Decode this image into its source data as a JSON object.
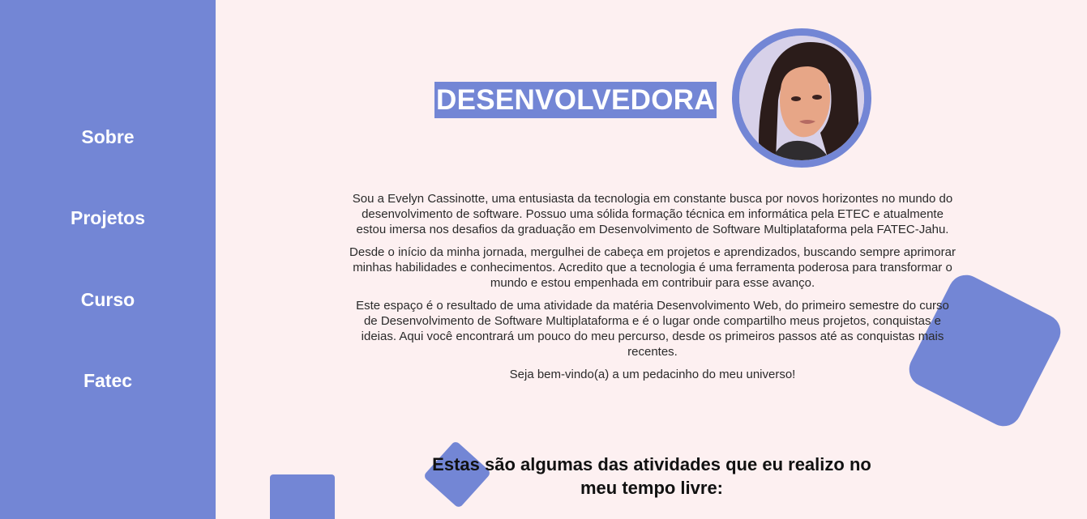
{
  "sidebar": {
    "items": [
      {
        "label": "Sobre"
      },
      {
        "label": "Projetos"
      },
      {
        "label": "Curso"
      },
      {
        "label": "Fatec"
      }
    ]
  },
  "header": {
    "title": "DESENVOLVEDORA"
  },
  "about": {
    "paragraphs": [
      "Sou a Evelyn Cassinotte, uma entusiasta da tecnologia em constante busca por novos horizontes no mundo do desenvolvimento de software. Possuo uma sólida formação técnica em informática pela ETEC e atualmente estou imersa nos desafios da graduação em Desenvolvimento de Software Multiplataforma pela FATEC-Jahu.",
      "Desde o início da minha jornada, mergulhei de cabeça em projetos e aprendizados, buscando sempre aprimorar minhas habilidades e conhecimentos. Acredito que a tecnologia é uma ferramenta poderosa para transformar o mundo e estou empenhada em contribuir para esse avanço.",
      "Este espaço é o resultado de uma atividade da matéria Desenvolvimento Web, do primeiro semestre do curso de Desenvolvimento de Software Multiplataforma e é o lugar onde compartilho meus projetos, conquistas e ideias. Aqui você encontrará um pouco do meu percurso, desde os primeiros passos até as conquistas mais recentes.",
      "Seja bem-vindo(a) a um pedacinho do meu universo!"
    ]
  },
  "activities": {
    "heading": "Estas são algumas das atividades que eu realizo no meu tempo livre:"
  },
  "colors": {
    "accent": "#7386d5",
    "background": "#fdf0f1"
  }
}
